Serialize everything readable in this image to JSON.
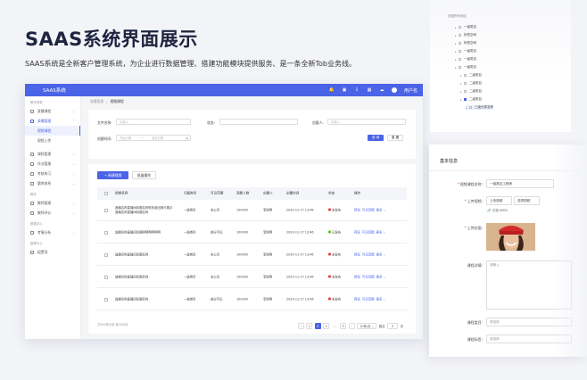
{
  "hero": {
    "title": "SAAS系统界面展示",
    "subtitle": "SAAS系统是全新客户管理系统，为企业进行数据管理、搭建功能模块提供服务、是一条全新Tob业务线。"
  },
  "app": {
    "brand": "SAAS系统",
    "user_label": "用户名",
    "accent": "#4b63e6"
  },
  "sidebar": {
    "group1": "教学资源",
    "items_top": [
      {
        "label": "直播课程"
      },
      {
        "label": "录播管理"
      }
    ],
    "sub_items": [
      "视频课程",
      "视频上传"
    ],
    "items_mid": [
      {
        "label": "课程管理"
      },
      {
        "label": "作业管理"
      },
      {
        "label": "考核练习"
      },
      {
        "label": "题库体系"
      }
    ],
    "group2": "教务",
    "items_edu": [
      {
        "label": "教师管理"
      },
      {
        "label": "教师评价"
      }
    ],
    "group3": "数据中心",
    "items_data": [
      {
        "label": "考情分析"
      }
    ],
    "group4": "管理中心",
    "items_mgmt": [
      {
        "label": "配置项"
      }
    ]
  },
  "breadcrumb": {
    "parent": "录播管理",
    "sep": "/",
    "current": "视频课程"
  },
  "filter": {
    "file_name_label": "文件名称:",
    "file_name_placeholder": "请输入",
    "status_label": "状态:",
    "creator_label": "创建人:",
    "creator_placeholder": "请输入",
    "time_label": "创建时间:",
    "start_placeholder": "开始日期",
    "range_sep": "→",
    "end_placeholder": "结束日期",
    "query_btn": "查 询",
    "reset_btn": "重 置"
  },
  "list": {
    "new_btn": "+ 新建视频",
    "batch_btn": "批量操作",
    "columns": [
      "视频名称",
      "归属类目",
      "可见范围",
      "观看人数",
      "创建人",
      "创建时间",
      "状态",
      "操作"
    ],
    "rows": [
      {
        "name1": "遥播名称直播间标题名称很多超出换行展示",
        "name2": "遥播名称直播间标题名称",
        "category": "一级类目",
        "scope": "全公司",
        "views": "100000",
        "creator": "李晓明",
        "time": "2020-11-17 13:46",
        "status": "未发布",
        "status_color": "#e4393c"
      },
      {
        "name1": "遥播名称直播间标题啊啊啊啊啊啊",
        "name2": "",
        "category": "一级类目",
        "scope": "部分可见",
        "views": "100000",
        "creator": "李晓明",
        "time": "2020-11-17 13:46",
        "status": "已发布",
        "status_color": "#52c41a"
      },
      {
        "name1": "遥播名称直播间标题名称",
        "name2": "",
        "category": "一级类目",
        "scope": "全公司",
        "views": "100000",
        "creator": "李晓明",
        "time": "2020-11-17 13:46",
        "status": "未发布",
        "status_color": "#e4393c"
      },
      {
        "name1": "遥播名称直播间标题名称",
        "name2": "",
        "category": "一级类目",
        "scope": "全公司",
        "views": "100000",
        "creator": "李晓明",
        "time": "2020-11-17 13:46",
        "status": "未发布",
        "status_color": "#e4393c"
      },
      {
        "name1": "遥播名称直播间标题名称",
        "name2": "",
        "category": "一级类目",
        "scope": "部分可见",
        "views": "100000",
        "creator": "李晓明",
        "time": "2020-11-17 13:46",
        "status": "未发布",
        "status_color": "#e4393c"
      }
    ],
    "ops": [
      "预览",
      "可见范围",
      "更多 ⌄"
    ],
    "total": "共400条记录 第1/80页",
    "pages": [
      "‹",
      "1",
      "2",
      "3",
      "…",
      "5",
      "›"
    ],
    "active_page": "2",
    "page_size": "10条/页",
    "jump_label": "跳至",
    "jump_value": "5",
    "jump_unit": "页"
  },
  "tree": {
    "root": "全国所有地区",
    "items": [
      {
        "label": "一级类目",
        "checked": false
      },
      {
        "label": "标签空间",
        "checked": false
      },
      {
        "label": "标签空间",
        "checked": false
      },
      {
        "label": "一级类目",
        "checked": false
      },
      {
        "label": "一级类目",
        "checked": false
      },
      {
        "label": "一级类目",
        "checked": false
      },
      {
        "label": "二级类目",
        "checked": false
      },
      {
        "label": "二级类目",
        "checked": false
      },
      {
        "label": "二级类目",
        "checked": false
      },
      {
        "label": "二级类目",
        "checked": true
      },
      {
        "label": "三级分类名称",
        "checked": false
      }
    ]
  },
  "info": {
    "title": "基本信息",
    "course_name_label": "视频课程名称:",
    "course_name_value": "一级类目工程师",
    "upload_video_label": "上传视频:",
    "upload_btn": "上传视频",
    "select_btn": "选择视频",
    "file_name": "文档.WMV",
    "cover_label": "上传封面:",
    "detail_label": "课程详情:",
    "detail_placeholder": "请输入",
    "category_label": "课程类目:",
    "category_placeholder": "请选择",
    "tags_label": "课程标签:",
    "tags_placeholder": "请选择"
  }
}
